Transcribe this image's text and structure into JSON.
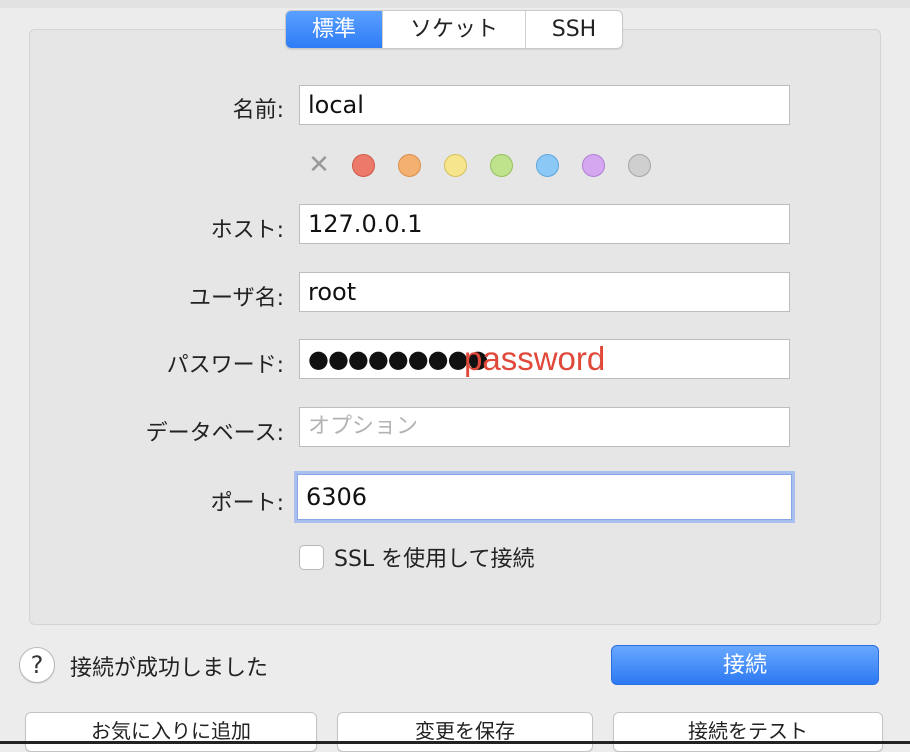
{
  "tabs": [
    {
      "label": "標準",
      "active": true
    },
    {
      "label": "ソケット",
      "active": false
    },
    {
      "label": "SSH",
      "active": false
    }
  ],
  "form": {
    "name": {
      "label": "名前:",
      "value": "local"
    },
    "host": {
      "label": "ホスト:",
      "value": "127.0.0.1"
    },
    "user": {
      "label": "ユーザ名:",
      "value": "root"
    },
    "password": {
      "label": "パスワード:",
      "value": "●●●●●●●●●",
      "annotation": "password"
    },
    "database": {
      "label": "データベース:",
      "placeholder": "オプション"
    },
    "port": {
      "label": "ポート:",
      "value": "6306"
    },
    "ssl": {
      "label": "SSL を使用して接続",
      "checked": false
    }
  },
  "favorite_colors": [
    {
      "name": "none",
      "icon": "x-icon"
    },
    {
      "name": "red",
      "hex": "#ec7a6b",
      "border": "#cf5848"
    },
    {
      "name": "orange",
      "hex": "#f3b070",
      "border": "#d9904b"
    },
    {
      "name": "yellow",
      "hex": "#f6e58c",
      "border": "#d6c15c"
    },
    {
      "name": "green",
      "hex": "#bfe28d",
      "border": "#95c25d"
    },
    {
      "name": "blue",
      "hex": "#8cc8f5",
      "border": "#5ea6dc"
    },
    {
      "name": "purple",
      "hex": "#d6a7f1",
      "border": "#b07ed4"
    },
    {
      "name": "gray",
      "hex": "#cfcfcf",
      "border": "#a5a5a5"
    }
  ],
  "status": {
    "help": "?",
    "message": "接続が成功しました"
  },
  "buttons": {
    "connect": "接続",
    "add_favorite": "お気に入りに追加",
    "save_changes": "変更を保存",
    "test_connection": "接続をテスト"
  }
}
